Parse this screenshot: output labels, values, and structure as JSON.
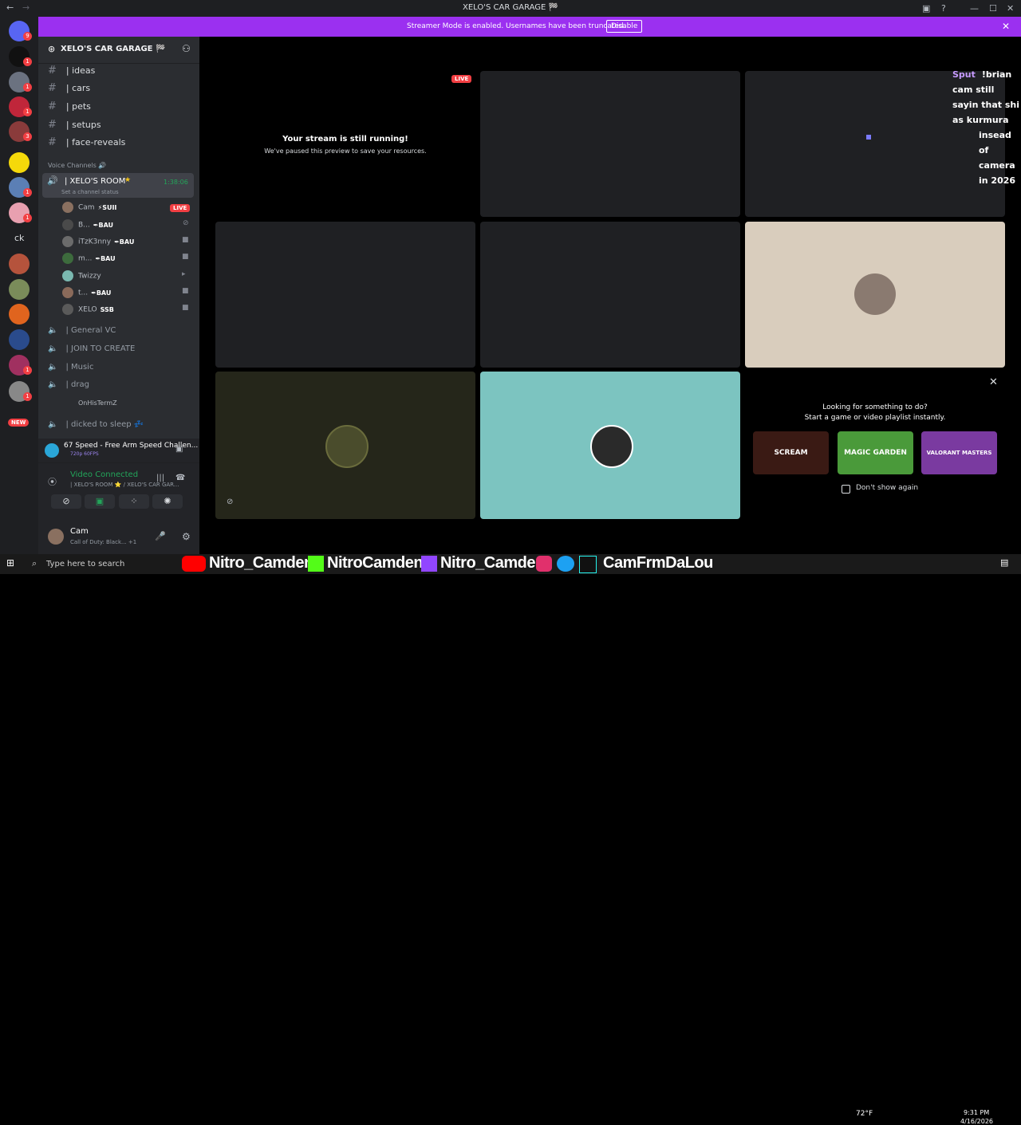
{
  "window": {
    "title": "XELO'S CAR GARAGE 🏁"
  },
  "banner": {
    "message": "Streamer Mode is enabled. Usernames have been truncated.",
    "button": "Disable"
  },
  "rail": {
    "badges": [
      "9",
      "1",
      "1",
      "1",
      "3",
      "1",
      "1",
      "1",
      "1"
    ],
    "text_item": "ck",
    "new_badge": "NEW"
  },
  "server": {
    "name": "XELO'S CAR GARAGE 🏁"
  },
  "channels": [
    "| ideas",
    "| cars",
    "| pets",
    "| setups",
    "| face-reveals"
  ],
  "voice_category": "Voice Channels 🔊",
  "active_voice": {
    "name": "| XELO'S ROOM",
    "timer": "1:38:06",
    "status": "Set a channel status"
  },
  "voice_users": [
    {
      "name": "Cam",
      "tag": "⚡SUII",
      "live": "LIVE"
    },
    {
      "name": "B...",
      "tag": "✒BAU"
    },
    {
      "name": "iTzK3nny",
      "tag": "✒BAU"
    },
    {
      "name": "m...",
      "tag": "✒BAU"
    },
    {
      "name": "Twizzy",
      "tag": ""
    },
    {
      "name": "t...",
      "tag": "✒BAU"
    },
    {
      "name": "XELO",
      "tag": "SSB"
    }
  ],
  "other_voice": [
    "| General VC",
    "| JOIN TO CREATE",
    "| Music",
    "| drag"
  ],
  "drag_user": "OnHisTermZ",
  "sleep_channel": "| dicked to sleep 💤",
  "activity": {
    "title": "67 Speed - Free Arm Speed Challen...",
    "sub": "720p 60FPS"
  },
  "connection": {
    "status": "Video Connected",
    "location": "| XELO'S ROOM ⭐ / XELO'S CAR GAR..."
  },
  "user": {
    "name": "Cam",
    "status": "Call of Duty: Black... +1"
  },
  "stage": {
    "live": "LIVE",
    "paused_title": "Your stream is still running!",
    "paused_sub": "We've paused this preview to save your resources."
  },
  "chat": {
    "user": "Sput",
    "line1": "!brian cam still sayin that shi as kurmura",
    "line2": "insead of camera in 2026"
  },
  "suggest": {
    "title": "Looking for something to do?",
    "sub": "Start a game or video playlist instantly.",
    "games": [
      "SCREAM",
      "MAGIC GARDEN",
      "VALORANT MASTERS"
    ],
    "checkbox": "Don't show again"
  },
  "overlay": [
    "Nitro_Camden",
    "NitroCamden",
    "Nitro_Camden",
    "CamFrmDaLou"
  ],
  "taskbar": {
    "search": "Type here to search",
    "temp": "72°F",
    "time": "9:31 PM",
    "date": "4/16/2026"
  },
  "colors": {
    "brand": "#5865f2",
    "banner": "#9b30f0",
    "live": "#f23f43",
    "connected": "#23a55a"
  }
}
